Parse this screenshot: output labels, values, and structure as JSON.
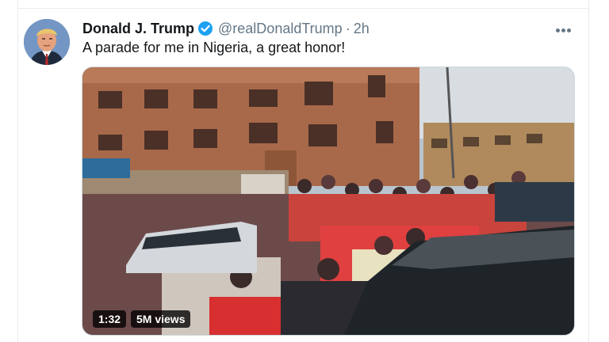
{
  "tweet": {
    "display_name": "Donald J. Trump",
    "handle": "@realDonaldTrump",
    "separator": "·",
    "timestamp": "2h",
    "text": "A parade for me in Nigeria, a great honor!",
    "verified": true,
    "more_icon": "more-horizontal-icon"
  },
  "media": {
    "type": "video",
    "duration": "1:32",
    "views": "5M views"
  },
  "colors": {
    "text": "#14171a",
    "secondary": "#657786",
    "verified": "#1da1f2",
    "border": "#e6ecf0"
  }
}
